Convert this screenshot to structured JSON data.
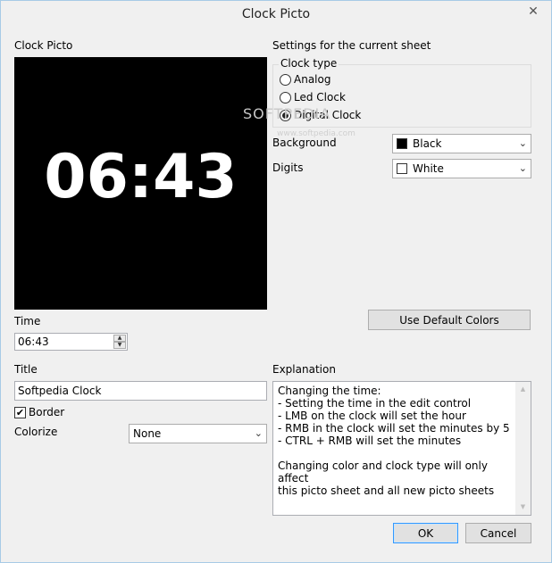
{
  "window": {
    "title": "Clock Picto",
    "close_glyph": "✕"
  },
  "left": {
    "preview_label": "Clock Picto",
    "clock_display": "06:43",
    "time_label": "Time",
    "time_value": "06:43",
    "title_label": "Title",
    "title_value": "Softpedia Clock",
    "border_label": "Border",
    "border_checked": true,
    "colorize_label": "Colorize",
    "colorize_value": "None"
  },
  "settings": {
    "heading": "Settings for  the current sheet",
    "clock_type_label": "Clock type",
    "clock_types": [
      {
        "label": "Analog",
        "selected": false
      },
      {
        "label": "Led Clock",
        "selected": false
      },
      {
        "label": "Digital Clock",
        "selected": true
      }
    ],
    "background_label": "Background",
    "background_value": "Black",
    "background_color": "#000000",
    "digits_label": "Digits",
    "digits_value": "White",
    "digits_color": "#ffffff",
    "default_colors_button": "Use Default Colors"
  },
  "explanation": {
    "label": "Explanation",
    "text": "Changing the time:\n- Setting the time in the edit control\n- LMB on the clock will set the hour\n- RMB in the clock will set the minutes by 5\n- CTRL + RMB will set the minutes\n\nChanging color and clock type will only affect\nthis picto sheet and all new picto sheets"
  },
  "buttons": {
    "ok": "OK",
    "cancel": "Cancel"
  },
  "watermark": {
    "text": "SOFTPEDIA",
    "sub": "www.softpedia.com"
  },
  "icons": {
    "checkmark": "✔",
    "dropdown": "⌄",
    "spin_up": "▲",
    "spin_down": "▼",
    "scroll_up": "▲",
    "scroll_down": "▼"
  }
}
